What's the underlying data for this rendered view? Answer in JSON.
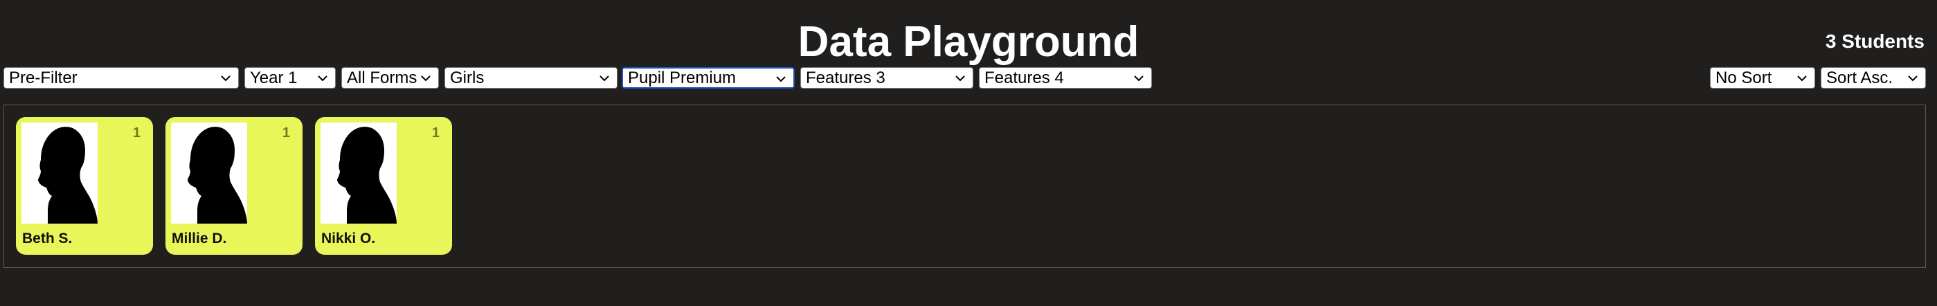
{
  "header": {
    "title": "Data Playground",
    "student_count": "3 Students"
  },
  "filters": {
    "prefilter": "Pre-Filter",
    "year": "Year 1",
    "forms": "All Forms",
    "gender": "Girls",
    "feature_2": "Pupil Premium",
    "feature_3": "Features 3",
    "feature_4": "Features 4"
  },
  "sort": {
    "field": "No Sort",
    "order": "Sort Asc."
  },
  "students": [
    {
      "name": "Beth S.",
      "count": "1"
    },
    {
      "name": "Millie D.",
      "count": "1"
    },
    {
      "name": "Nikki O.",
      "count": "1"
    }
  ],
  "colors": {
    "background": "#201f1e",
    "card": "#e8f65a",
    "focus_border": "#1f4fb8"
  },
  "icons": {
    "dropdown": "chevron-down-icon",
    "photo": "person-silhouette-icon"
  }
}
